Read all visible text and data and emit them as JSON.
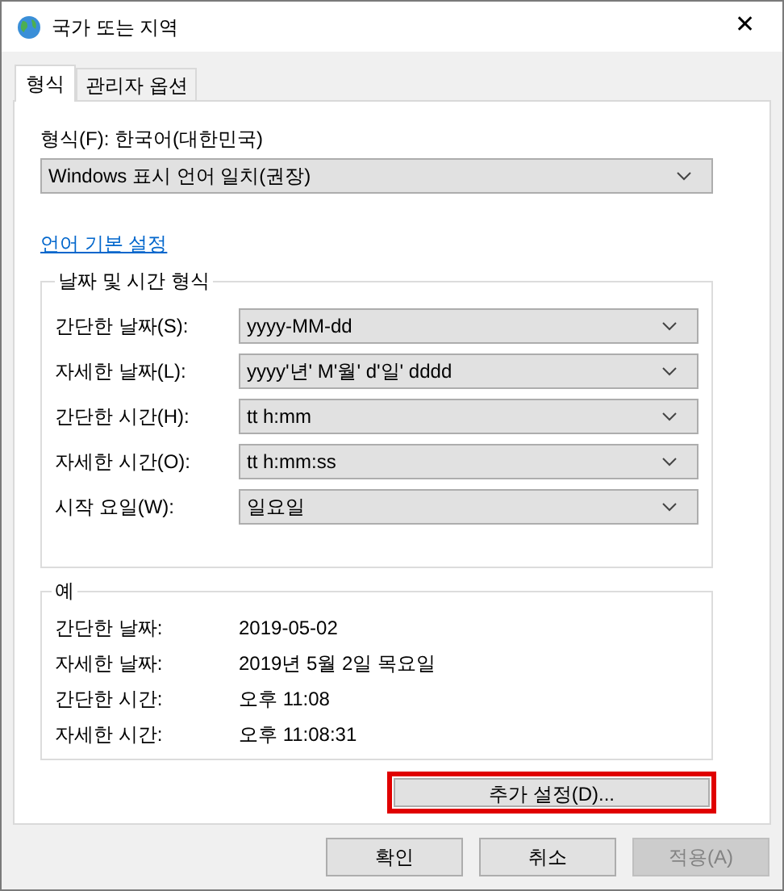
{
  "window": {
    "title": "국가 또는 지역",
    "close": "✕"
  },
  "tabs": [
    {
      "label": "형식",
      "selected": true
    },
    {
      "label": "관리자 옵션",
      "selected": false
    }
  ],
  "format": {
    "label": "형식(F): 한국어(대한민국)",
    "value": "Windows 표시 언어 일치(권장)"
  },
  "language_link": "언어 기본 설정",
  "date_time_formats": {
    "title": "날짜 및 시간 형식",
    "rows": [
      {
        "label": "간단한 날짜(S):",
        "value": "yyyy-MM-dd"
      },
      {
        "label": "자세한 날짜(L):",
        "value": "yyyy'년' M'월' d'일' dddd"
      },
      {
        "label": "간단한 시간(H):",
        "value": "tt h:mm"
      },
      {
        "label": "자세한 시간(O):",
        "value": "tt h:mm:ss"
      },
      {
        "label": "시작 요일(W):",
        "value": "일요일"
      }
    ]
  },
  "examples": {
    "title": "예",
    "rows": [
      {
        "label": "간단한 날짜:",
        "value": "2019-05-02"
      },
      {
        "label": "자세한 날짜:",
        "value": "2019년 5월 2일 목요일"
      },
      {
        "label": "간단한 시간:",
        "value": "오후 11:08"
      },
      {
        "label": "자세한 시간:",
        "value": "오후 11:08:31"
      }
    ]
  },
  "additional_settings": {
    "label": "추가 설정(D)...",
    "highlighted": true
  },
  "buttons": [
    {
      "label": "확인",
      "disabled": false
    },
    {
      "label": "취소",
      "disabled": false
    },
    {
      "label": "적용(A)",
      "disabled": true
    }
  ]
}
